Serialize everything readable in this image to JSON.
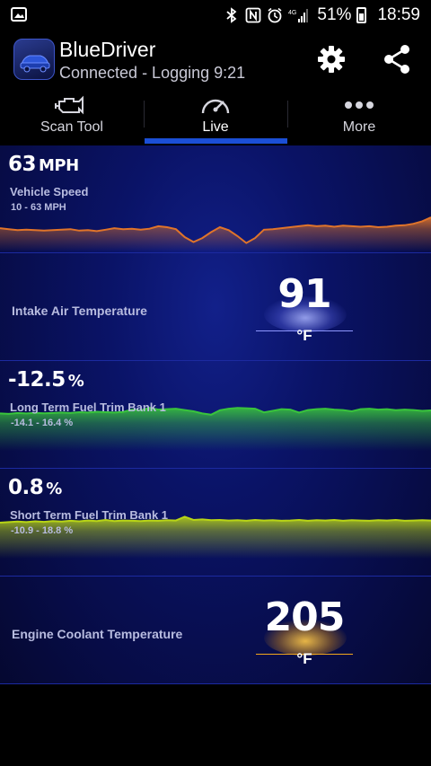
{
  "status_bar": {
    "battery_percent": "51%",
    "time": "18:59",
    "network": "4G"
  },
  "header": {
    "app_name": "BlueDriver",
    "status": "Connected - Logging 9:21",
    "settings_icon": "gear-icon",
    "share_icon": "share-icon"
  },
  "tabs": [
    {
      "label": "Scan Tool",
      "icon": "engine-icon"
    },
    {
      "label": "Live",
      "icon": "speedometer-icon",
      "active": true
    },
    {
      "label": "More",
      "icon": "more-dots-icon"
    }
  ],
  "gauges": {
    "vehicle_speed": {
      "value": "63",
      "unit": "MPH",
      "name": "Vehicle Speed",
      "range": "10 - 63 MPH",
      "color": "#e0742a",
      "trace": [
        0.38,
        0.36,
        0.34,
        0.35,
        0.34,
        0.33,
        0.34,
        0.35,
        0.36,
        0.33,
        0.34,
        0.32,
        0.35,
        0.38,
        0.36,
        0.37,
        0.35,
        0.37,
        0.42,
        0.4,
        0.36,
        0.2,
        0.1,
        0.18,
        0.3,
        0.4,
        0.34,
        0.22,
        0.08,
        0.18,
        0.35,
        0.36,
        0.38,
        0.4,
        0.42,
        0.44,
        0.42,
        0.43,
        0.41,
        0.43,
        0.42,
        0.41,
        0.42,
        0.4,
        0.41,
        0.43,
        0.44,
        0.47,
        0.52,
        0.6
      ]
    },
    "intake_air_temp": {
      "value": "91",
      "unit": "°F",
      "name": "Intake Air Temperature",
      "color": "#6f7cff"
    },
    "long_term_fuel_trim": {
      "value": "-12.5",
      "unit": "%",
      "name": "Long Term Fuel Trim Bank 1",
      "range": "-14.1 - 16.4 %",
      "color": "#39c43c",
      "trace": [
        0.4,
        0.38,
        0.42,
        0.4,
        0.43,
        0.41,
        0.42,
        0.44,
        0.42,
        0.46,
        0.44,
        0.48,
        0.46,
        0.44,
        0.47,
        0.58,
        0.54,
        0.66,
        0.58,
        0.6,
        0.62,
        0.56,
        0.5,
        0.4,
        0.34,
        0.55,
        0.62,
        0.66,
        0.64,
        0.62,
        0.45,
        0.52,
        0.6,
        0.58,
        0.44,
        0.56,
        0.6,
        0.62,
        0.58,
        0.56,
        0.5,
        0.6,
        0.62,
        0.58,
        0.6,
        0.55,
        0.58,
        0.56,
        0.52,
        0.54
      ]
    },
    "short_term_fuel_trim": {
      "value": "0.8",
      "unit": "%",
      "name": "Short Term Fuel Trim Bank 1",
      "range": "-10.9 - 18.8 %",
      "color": "#b8d416",
      "trace": [
        0.4,
        0.42,
        0.44,
        0.42,
        0.45,
        0.43,
        0.46,
        0.44,
        0.47,
        0.45,
        0.48,
        0.46,
        0.5,
        0.46,
        0.48,
        0.47,
        0.46,
        0.48,
        0.47,
        0.49,
        0.48,
        0.62,
        0.5,
        0.52,
        0.49,
        0.5,
        0.48,
        0.49,
        0.47,
        0.5,
        0.48,
        0.49,
        0.47,
        0.48,
        0.5,
        0.47,
        0.49,
        0.48,
        0.5,
        0.47,
        0.49,
        0.48,
        0.47,
        0.49,
        0.48,
        0.5,
        0.47,
        0.48,
        0.49,
        0.48
      ]
    },
    "engine_coolant_temp": {
      "value": "205",
      "unit": "°F",
      "name": "Engine Coolant Temperature",
      "color": "#f2a81c"
    }
  }
}
